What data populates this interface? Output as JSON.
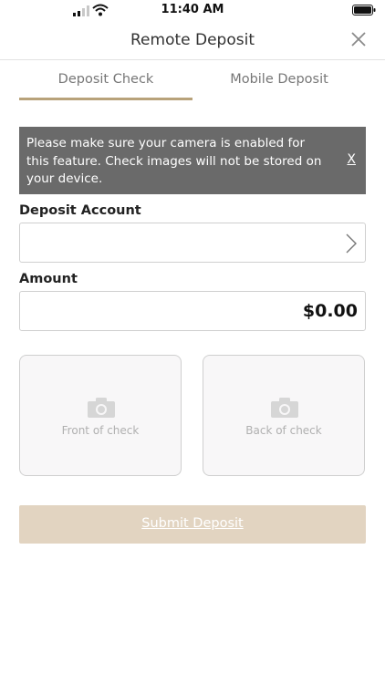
{
  "status_bar": {
    "time": "11:40 AM"
  },
  "header": {
    "title": "Remote Deposit",
    "close_icon": "close-icon"
  },
  "tabs": [
    {
      "label": "Deposit Check",
      "active": true
    },
    {
      "label": "Mobile Deposit",
      "active": false
    }
  ],
  "alert": {
    "message": "Please make sure your camera is enabled for this feature. Check images will not be stored on your device.",
    "dismiss_label": "X"
  },
  "deposit_account": {
    "label": "Deposit Account",
    "value": ""
  },
  "amount": {
    "label": "Amount",
    "value": "$0.00"
  },
  "check_images": {
    "front_label": "Front of check",
    "back_label": "Back of check"
  },
  "submit": {
    "label": "Submit Deposit"
  },
  "colors": {
    "accent": "#b8a27a",
    "alert_bg": "#6a6a6a",
    "submit_bg": "#e2d4c1"
  }
}
